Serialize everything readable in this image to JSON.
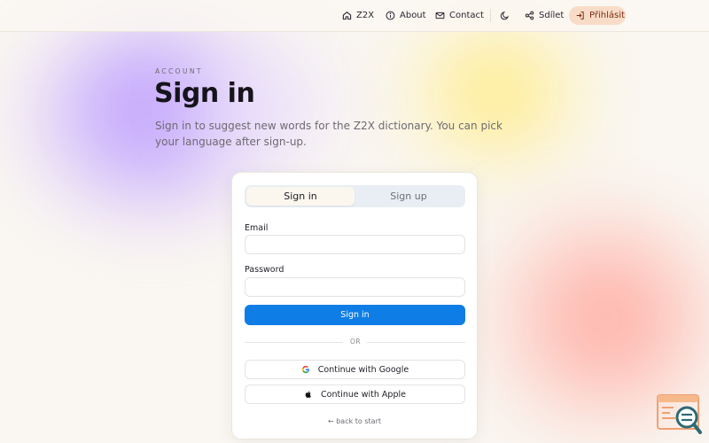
{
  "nav": {
    "brand_label": "Z2X",
    "about_label": "About",
    "contact_label": "Contact",
    "share_label": "Sdílet",
    "login_label": "Přihlásit",
    "icons": [
      "home-icon",
      "info-icon",
      "mail-icon",
      "moon-icon",
      "share-icon",
      "login-icon"
    ]
  },
  "hero": {
    "eyebrow": "ACCOUNT",
    "title": "Sign in",
    "subtitle": "Sign in to suggest new words for the Z2X dictionary. You can pick your language after sign-up."
  },
  "auth_card": {
    "tabs": [
      {
        "label": "Sign in",
        "active": true
      },
      {
        "label": "Sign up",
        "active": false
      }
    ],
    "email_label": "Email",
    "email_value": "",
    "password_label": "Password",
    "password_value": "",
    "submit_label": "Sign in",
    "divider_text": "OR",
    "google_label": "Continue with Google",
    "apple_label": "Continue with Apple",
    "back_link": "← back to start"
  },
  "colors": {
    "primary": "#0f7de6",
    "login_pill": "#f9dcc7",
    "background": "#faf7f2"
  }
}
